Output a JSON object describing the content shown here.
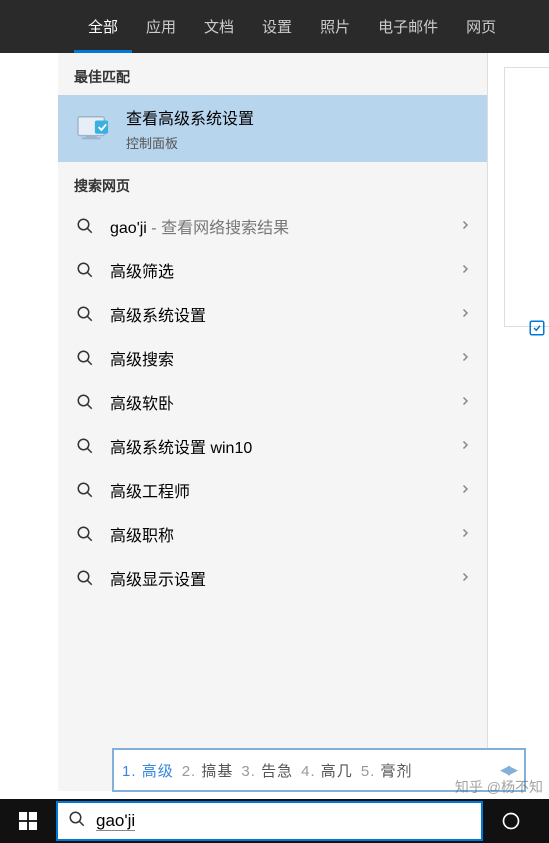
{
  "tabs": {
    "items": [
      "全部",
      "应用",
      "文档",
      "设置",
      "照片",
      "电子邮件",
      "网页"
    ],
    "active": 0
  },
  "sections": {
    "best_match_header": "最佳匹配",
    "web_header": "搜索网页"
  },
  "best_match": {
    "title": "查看高级系统设置",
    "subtitle": "控制面板"
  },
  "web_results": [
    {
      "text": "gao'ji",
      "suffix": " - 查看网络搜索结果"
    },
    {
      "text": "高级筛选"
    },
    {
      "text": "高级系统设置"
    },
    {
      "text": "高级搜索"
    },
    {
      "text": "高级软卧"
    },
    {
      "text": "高级系统设置 win10"
    },
    {
      "text": "高级工程师"
    },
    {
      "text": "高级职称"
    },
    {
      "text": "高级显示设置"
    }
  ],
  "ime": {
    "candidates": [
      {
        "num": "1.",
        "text": "高级",
        "selected": true
      },
      {
        "num": "2.",
        "text": "搞基"
      },
      {
        "num": "3.",
        "text": "告急"
      },
      {
        "num": "4.",
        "text": "高几"
      },
      {
        "num": "5.",
        "text": "膏剂"
      }
    ]
  },
  "search": {
    "query": "gao'ji"
  },
  "watermark": "知乎 @杨不知"
}
